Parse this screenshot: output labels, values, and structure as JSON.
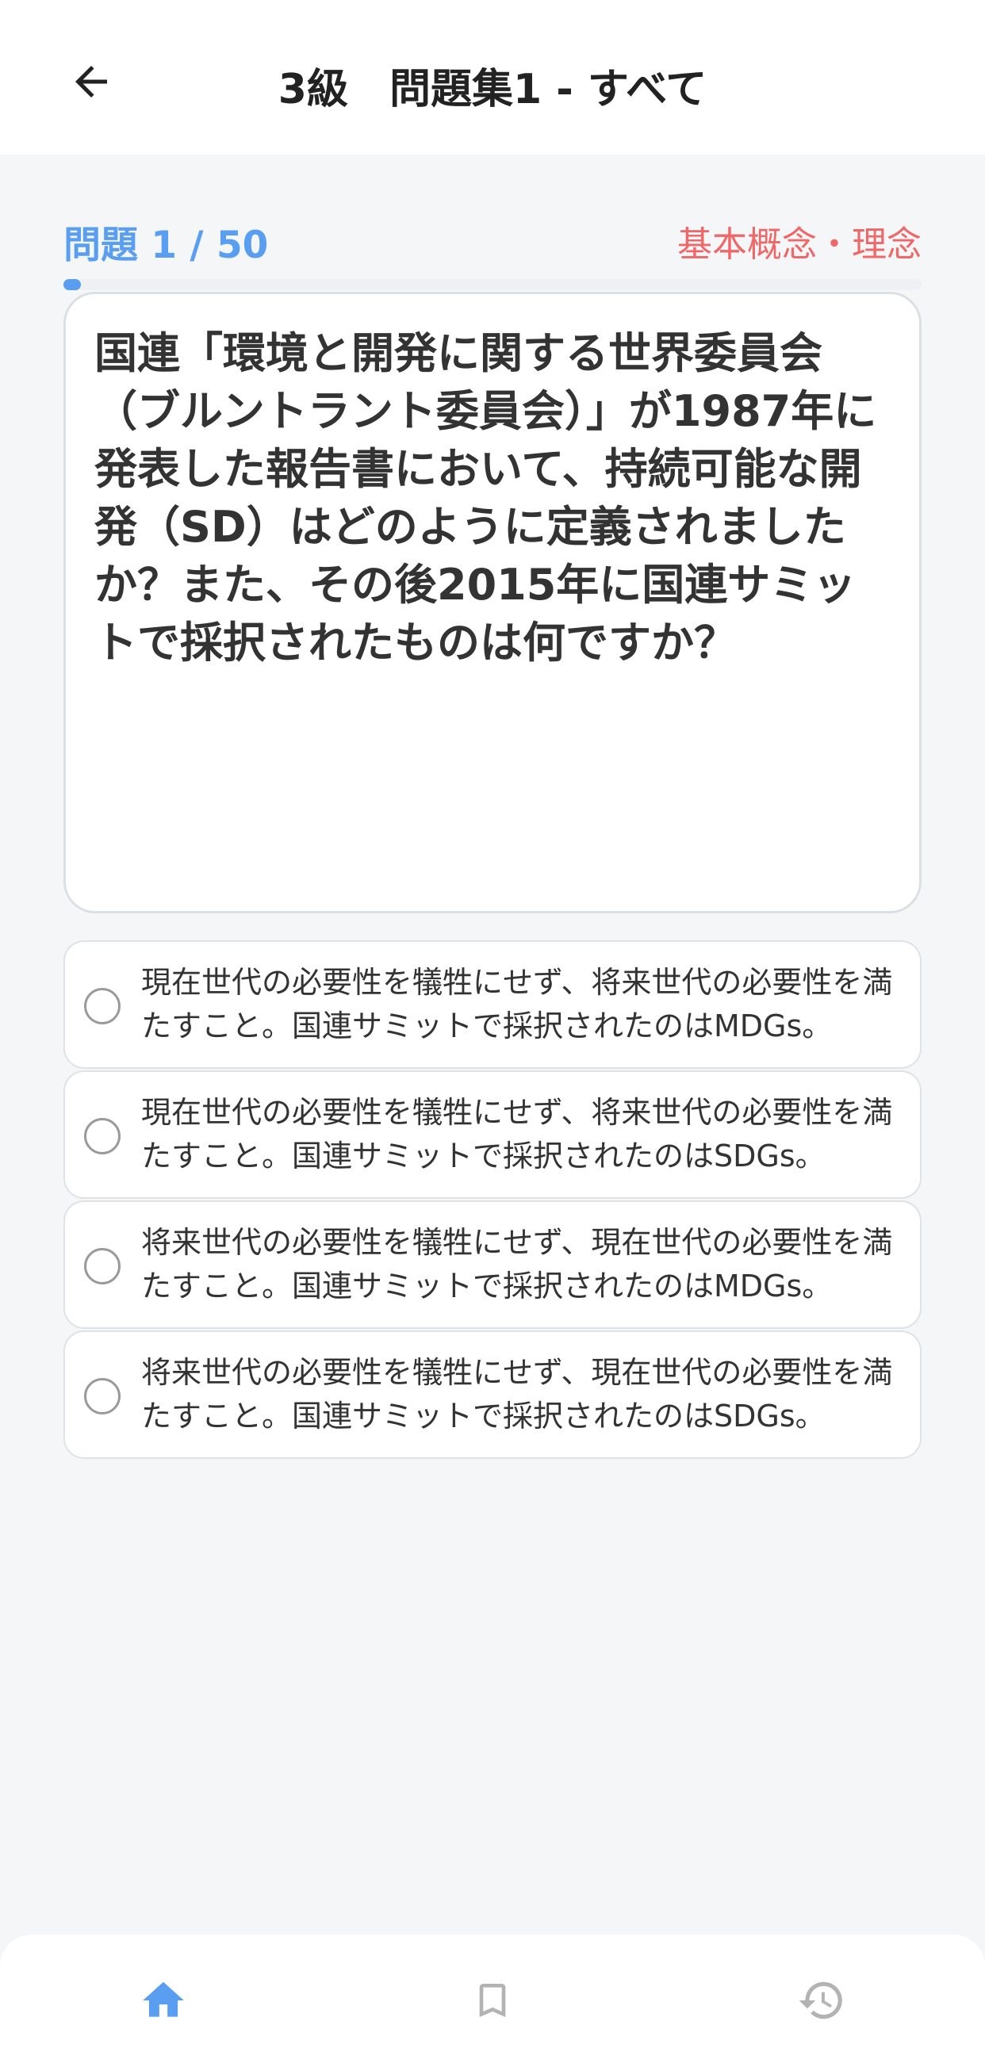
{
  "header": {
    "title": "3級　問題集1 - すべて",
    "back_icon": "arrow-left-icon"
  },
  "progress": {
    "counter": "問題 1 / 50",
    "category": "基本概念・理念",
    "current": 1,
    "total": 50,
    "fraction": 0.02
  },
  "question": {
    "text": "国連「環境と開発に関する世界委員会（ブルントラント委員会）」が1987年に発表した報告書において、持続可能な開発（SD）はどのように定義されましたか？また、その後2015年に国連サミットで採択されたものは何ですか？"
  },
  "choices": [
    {
      "text": "現在世代の必要性を犠牲にせず、将来世代の必要性を満たすこと。国連サミットで採択されたのはMDGs。"
    },
    {
      "text": "現在世代の必要性を犠牲にせず、将来世代の必要性を満たすこと。国連サミットで採択されたのはSDGs。"
    },
    {
      "text": "将来世代の必要性を犠牲にせず、現在世代の必要性を満たすこと。国連サミットで採択されたのはMDGs。"
    },
    {
      "text": "将来世代の必要性を犠牲にせず、現在世代の必要性を満たすこと。国連サミットで採択されたのはSDGs。"
    }
  ],
  "nav": {
    "items": [
      {
        "icon": "home-icon",
        "active": true
      },
      {
        "icon": "bookmark-icon",
        "active": false
      },
      {
        "icon": "history-icon",
        "active": false
      }
    ]
  },
  "colors": {
    "accent": "#5a9ef2",
    "category": "#f06767",
    "inactive": "#b3b3b3"
  }
}
